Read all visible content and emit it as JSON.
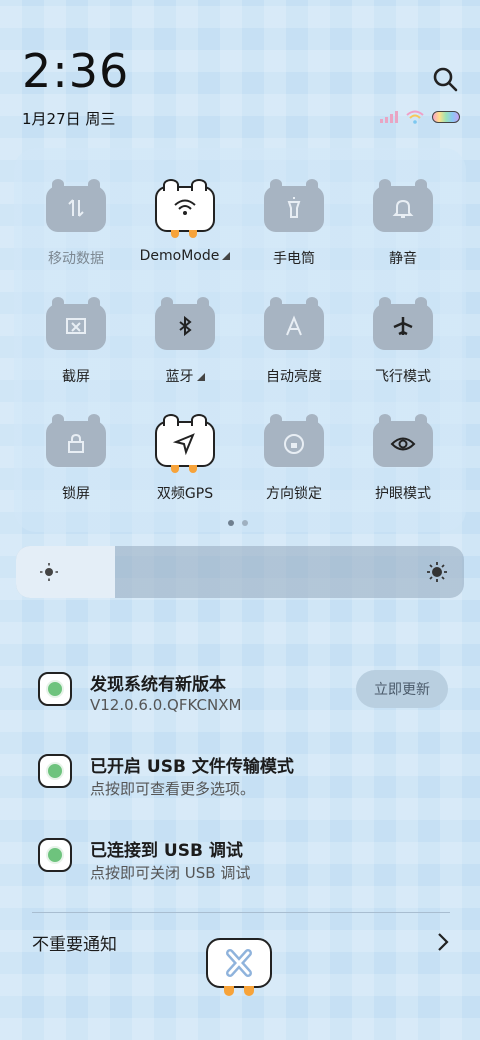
{
  "status": {
    "time": "2:36",
    "date": "1月27日 周三"
  },
  "tiles": [
    {
      "label": "移动数据",
      "icon": "mobile-data-icon",
      "active": false,
      "dim": true,
      "arrow": false
    },
    {
      "label": "DemoMode",
      "icon": "wifi-icon",
      "active": true,
      "dim": false,
      "arrow": true
    },
    {
      "label": "手电筒",
      "icon": "flashlight-icon",
      "active": false,
      "dim": false,
      "arrow": false
    },
    {
      "label": "静音",
      "icon": "bell-icon",
      "active": false,
      "dim": false,
      "arrow": false
    },
    {
      "label": "截屏",
      "icon": "screenshot-icon",
      "active": false,
      "dim": false,
      "arrow": false
    },
    {
      "label": "蓝牙",
      "icon": "bluetooth-icon",
      "active": false,
      "dim": false,
      "arrow": true
    },
    {
      "label": "自动亮度",
      "icon": "auto-brightness-icon",
      "active": false,
      "dim": false,
      "arrow": false
    },
    {
      "label": "飞行模式",
      "icon": "airplane-icon",
      "active": false,
      "dim": false,
      "arrow": false
    },
    {
      "label": "锁屏",
      "icon": "lock-icon",
      "active": false,
      "dim": false,
      "arrow": false
    },
    {
      "label": "双频GPS",
      "icon": "gps-icon",
      "active": true,
      "dim": false,
      "arrow": false
    },
    {
      "label": "方向锁定",
      "icon": "rotation-lock-icon",
      "active": false,
      "dim": false,
      "arrow": false
    },
    {
      "label": "护眼模式",
      "icon": "eye-icon",
      "active": false,
      "dim": false,
      "arrow": false
    }
  ],
  "brightness": {
    "level": 0.22
  },
  "notifications": [
    {
      "title": "发现系统有新版本",
      "subtitle": "V12.0.6.0.QFKCNXM",
      "action": "立即更新"
    },
    {
      "title": "已开启 USB 文件传输模式",
      "subtitle": "点按即可查看更多选项。"
    },
    {
      "title": "已连接到 USB 调试",
      "subtitle": "点按即可关闭 USB 调试"
    }
  ],
  "footer": {
    "label": "不重要通知"
  },
  "colors": {
    "accent": "#f7a33a",
    "tile_off": "#a7b4c2",
    "tile_on": "#ffffff"
  }
}
